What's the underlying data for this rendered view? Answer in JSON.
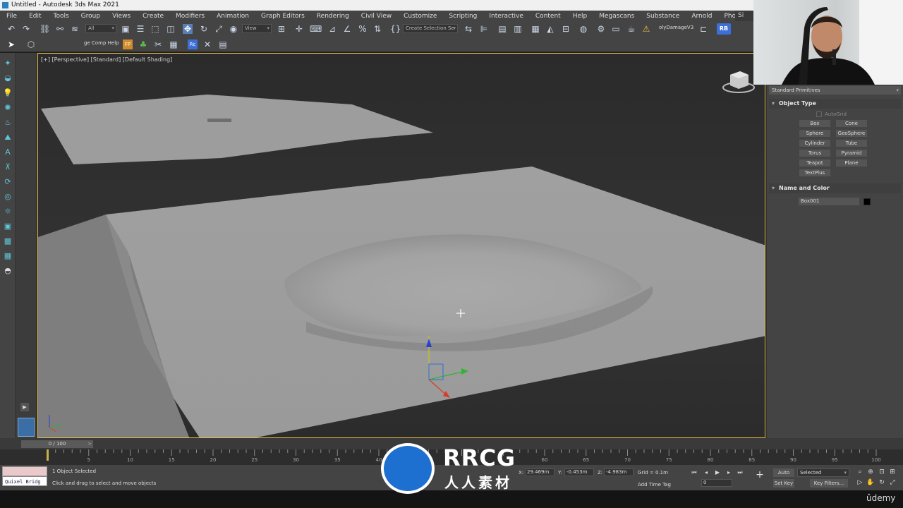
{
  "window": {
    "title": "Untitled - Autodesk 3ds Max 2021"
  },
  "menu": [
    "File",
    "Edit",
    "Tools",
    "Group",
    "Views",
    "Create",
    "Modifiers",
    "Animation",
    "Graph Editors",
    "Rendering",
    "Civil View",
    "Customize",
    "Scripting",
    "Interactive",
    "Content",
    "Help",
    "Megascans",
    "Substance",
    "Arnold",
    "Phoenix FD"
  ],
  "menu_right_stub": "Si",
  "toolbar": {
    "filter_value": "All",
    "ref_coord_value": "View",
    "selection_set_placeholder": "Create Selection Se",
    "poly_damage_label": "olyDamageV3",
    "rb_label": "RB",
    "edge_comp_label": "ge Comp Help",
    "fp_label": "FP"
  },
  "viewport": {
    "label": "[+] [Perspective] [Standard] [Default Shading]"
  },
  "command_panel": {
    "category": "Standard Primitives",
    "object_type": {
      "title": "Object Type",
      "autogrid": "AutoGrid",
      "buttons": [
        "Box",
        "Cone",
        "Sphere",
        "GeoSphere",
        "Cylinder",
        "Tube",
        "Torus",
        "Pyramid",
        "Teapot",
        "Plane",
        "TextPlus"
      ]
    },
    "name_color": {
      "title": "Name and Color",
      "name": "Box001",
      "color": "#000000"
    }
  },
  "timeline": {
    "frame_display": "0 / 100",
    "ticks": [
      "5",
      "10",
      "15",
      "20",
      "25",
      "30",
      "35",
      "40",
      "60",
      "65",
      "70",
      "75",
      "80",
      "85",
      "90",
      "95",
      "100"
    ]
  },
  "status": {
    "quixel": "Quixel Bridg",
    "selection_count": "1 Object Selected",
    "prompt": "Click and drag to select and move objects",
    "x_label": "X:",
    "x_value": "29.469m",
    "y_label": "Y:",
    "y_value": "-0.453m",
    "z_label": "Z:",
    "z_value": "-4.983m",
    "grid": "Grid = 0.1m",
    "add_time_tag": "Add Time Tag",
    "frame_value": "0",
    "auto_key": "Auto Key",
    "set_key": "Set Key",
    "key_mode": "Selected",
    "key_filters": "Key Filters..."
  },
  "watermark": {
    "rrcg": "RRCG",
    "cn": "人人素材"
  },
  "udemy": "ûdemy",
  "colors": {
    "viewport_border": "#e5c24a",
    "rb_badge": "#3c6fd8",
    "selection_swatch": "#000000"
  }
}
